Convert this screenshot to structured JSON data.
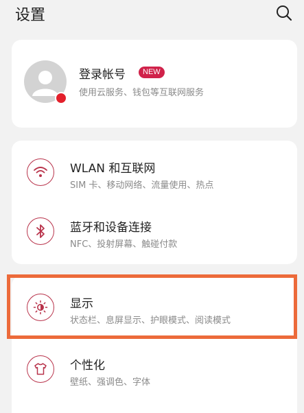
{
  "header": {
    "title": "设置",
    "search_icon": "search-icon"
  },
  "account": {
    "title": "登录帐号",
    "badge": "NEW",
    "subtitle": "使用云服务、钱包等互联网服务",
    "avatar_icon": "user-avatar-icon",
    "notification_color": "#e3202b"
  },
  "connections": [
    {
      "title": "WLAN 和互联网",
      "subtitle": "SIM 卡、移动网络、流量使用、热点",
      "icon": "wifi-icon"
    },
    {
      "title": "蓝牙和设备连接",
      "subtitle": "NFC、投射屏幕、触碰付款",
      "icon": "bluetooth-icon"
    }
  ],
  "lower": [
    {
      "title": "显示",
      "subtitle": "状态栏、息屏显示、护眼模式、阅读模式",
      "icon": "brightness-icon",
      "highlighted": true
    },
    {
      "title": "个性化",
      "subtitle": "壁纸、强调色、字体",
      "icon": "tshirt-icon"
    }
  ],
  "colors": {
    "accent": "#b8324a",
    "badge": "#d0224a",
    "highlight": "#ec6a3a",
    "background": "#f2f2f2"
  }
}
